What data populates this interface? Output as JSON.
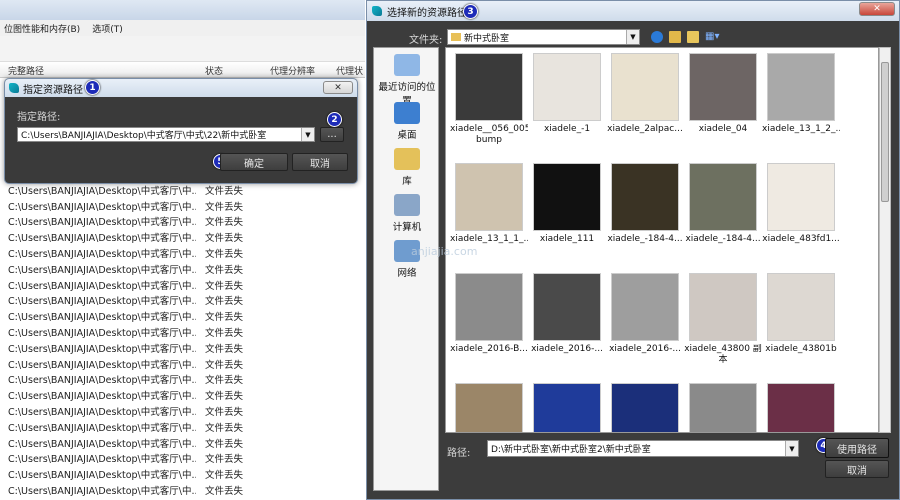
{
  "background": {
    "menu": [
      "位图性能和内存(B)",
      "选项(T)"
    ],
    "columns": {
      "path": "完整路径",
      "status": "状态",
      "proxy_res": "代理分辨率",
      "proxy_status": "代理状"
    },
    "rows": [
      {
        "path": "C:\\Users\\BANJIAJIA\\Desktop\\中式客厅\\中...",
        "status": "文件丢失"
      },
      {
        "path": "C:\\Users\\BANJIAJIA\\Desktop\\中式客厅\\中...",
        "status": "文件丢失"
      },
      {
        "path": "C:\\Users\\BANJIAJIA\\Desktop\\中式客厅\\中...",
        "status": "文件丢失"
      },
      {
        "path": "C:\\Users\\BANJIAJIA\\Desktop\\中式客厅\\中...",
        "status": "文件丢失"
      },
      {
        "path": "C:\\Users\\BANJIAJIA\\Desktop\\中式客厅\\中...",
        "status": "文件丢失"
      },
      {
        "path": "C:\\Users\\BANJIAJIA\\Desktop\\中式客厅\\中...",
        "status": "文件丢失"
      },
      {
        "path": "C:\\Users\\BANJIAJIA\\Desktop\\中式客厅\\中...",
        "status": "文件丢失"
      },
      {
        "path": "C:\\Users\\BANJIAJIA\\Desktop\\中式客厅\\中...",
        "status": "文件丢失"
      },
      {
        "path": "C:\\Users\\BANJIAJIA\\Desktop\\中式客厅\\中...",
        "status": "文件丢失"
      },
      {
        "path": "C:\\Users\\BANJIAJIA\\Desktop\\中式客厅\\中...",
        "status": "文件丢失"
      },
      {
        "path": "C:\\Users\\BANJIAJIA\\Desktop\\中式客厅\\中...",
        "status": "文件丢失"
      },
      {
        "path": "C:\\Users\\BANJIAJIA\\Desktop\\中式客厅\\中...",
        "status": "文件丢失"
      },
      {
        "path": "C:\\Users\\BANJIAJIA\\Desktop\\中式客厅\\中...",
        "status": "文件丢失"
      },
      {
        "path": "C:\\Users\\BANJIAJIA\\Desktop\\中式客厅\\中...",
        "status": "文件丢失"
      },
      {
        "path": "C:\\Users\\BANJIAJIA\\Desktop\\中式客厅\\中...",
        "status": "文件丢失"
      },
      {
        "path": "C:\\Users\\BANJIAJIA\\Desktop\\中式客厅\\中...",
        "status": "文件丢失"
      },
      {
        "path": "C:\\Users\\BANJIAJIA\\Desktop\\中式客厅\\中...",
        "status": "文件丢失"
      },
      {
        "path": "C:\\Users\\BANJIAJIA\\Desktop\\中式客厅\\中...",
        "status": "文件丢失"
      },
      {
        "path": "C:\\Users\\BANJIAJIA\\Desktop\\中式客厅\\中...",
        "status": "文件丢失"
      },
      {
        "path": "C:\\Users\\BANJIAJIA\\Desktop\\中式客厅\\中...",
        "status": "文件丢失"
      }
    ]
  },
  "specify_dialog": {
    "title": "指定资源路径",
    "badge": "1",
    "path_label": "指定路径:",
    "path_value": "C:\\Users\\BANJIAJIA\\Desktop\\中式客厅\\中式\\22\\新中式卧室",
    "browse_label": "...",
    "browse_badge": "2",
    "ok_label": "确定",
    "ok_badge": "5",
    "cancel_label": "取消"
  },
  "file_dialog": {
    "title": "选择新的资源路径",
    "badge": "3",
    "folder_label": "文件夹:",
    "folder_value": "新中式卧室",
    "places": [
      {
        "label": "最近访问的位置",
        "icon": "recent-places-icon"
      },
      {
        "label": "桌面",
        "icon": "desktop-icon"
      },
      {
        "label": "库",
        "icon": "library-icon"
      },
      {
        "label": "计算机",
        "icon": "computer-icon"
      },
      {
        "label": "网络",
        "icon": "network-icon"
      }
    ],
    "files": [
      {
        "name": "xiadele__056_005_wood-bump",
        "color": "#3a3a3a"
      },
      {
        "name": "xiadele_-1",
        "color": "#e8e4de"
      },
      {
        "name": "xiadele_2alpac...",
        "color": "#e9e1cf"
      },
      {
        "name": "xiadele_04",
        "color": "#6d6564"
      },
      {
        "name": "xiadele_13_1_2_...",
        "color": "#a9a9a9"
      },
      {
        "name": "xiadele_13_1_1_...",
        "color": "#cfc3af"
      },
      {
        "name": "xiadele_111",
        "color": "#111111"
      },
      {
        "name": "xiadele_-184-4...",
        "color": "#3a3324"
      },
      {
        "name": "xiadele_-184-4...",
        "color": "#6d7060"
      },
      {
        "name": "xiadele_483fd1...",
        "color": "#efeae2"
      },
      {
        "name": "xiadele_2016-B...",
        "color": "#8b8b8b"
      },
      {
        "name": "xiadele_2016-...",
        "color": "#4a4a4a"
      },
      {
        "name": "xiadele_2016-...",
        "color": "#9e9e9e"
      },
      {
        "name": "xiadele_43800 副本",
        "color": "#cfc8c2"
      },
      {
        "name": "xiadele_43801b",
        "color": "#ddd8d2"
      },
      {
        "name": "",
        "color": "#9b8668"
      },
      {
        "name": "",
        "color": "#1f3b9a"
      },
      {
        "name": "",
        "color": "#1b2f7a"
      },
      {
        "name": "",
        "color": "#8a8a8a"
      },
      {
        "name": "",
        "color": "#6b2f47"
      }
    ],
    "path_label": "路径:",
    "path_value": "D:\\新中式卧室\\新中式卧室2\\新中式卧室",
    "use_path_label": "使用路径",
    "use_path_badge": "4",
    "cancel_label": "取消",
    "watermark": "anjiajia.com",
    "close_label": "✕",
    "nav_icons": [
      "back-icon",
      "up-folder-icon",
      "new-folder-icon",
      "view-menu-icon"
    ]
  }
}
